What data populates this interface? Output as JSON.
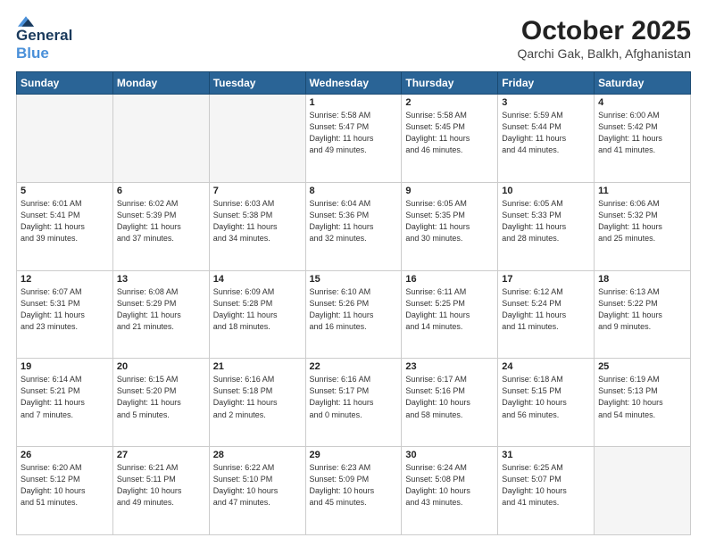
{
  "header": {
    "logo_general": "General",
    "logo_blue": "Blue",
    "month_title": "October 2025",
    "location": "Qarchi Gak, Balkh, Afghanistan"
  },
  "days_of_week": [
    "Sunday",
    "Monday",
    "Tuesday",
    "Wednesday",
    "Thursday",
    "Friday",
    "Saturday"
  ],
  "weeks": [
    [
      {
        "day": "",
        "info": ""
      },
      {
        "day": "",
        "info": ""
      },
      {
        "day": "",
        "info": ""
      },
      {
        "day": "1",
        "info": "Sunrise: 5:58 AM\nSunset: 5:47 PM\nDaylight: 11 hours\nand 49 minutes."
      },
      {
        "day": "2",
        "info": "Sunrise: 5:58 AM\nSunset: 5:45 PM\nDaylight: 11 hours\nand 46 minutes."
      },
      {
        "day": "3",
        "info": "Sunrise: 5:59 AM\nSunset: 5:44 PM\nDaylight: 11 hours\nand 44 minutes."
      },
      {
        "day": "4",
        "info": "Sunrise: 6:00 AM\nSunset: 5:42 PM\nDaylight: 11 hours\nand 41 minutes."
      }
    ],
    [
      {
        "day": "5",
        "info": "Sunrise: 6:01 AM\nSunset: 5:41 PM\nDaylight: 11 hours\nand 39 minutes."
      },
      {
        "day": "6",
        "info": "Sunrise: 6:02 AM\nSunset: 5:39 PM\nDaylight: 11 hours\nand 37 minutes."
      },
      {
        "day": "7",
        "info": "Sunrise: 6:03 AM\nSunset: 5:38 PM\nDaylight: 11 hours\nand 34 minutes."
      },
      {
        "day": "8",
        "info": "Sunrise: 6:04 AM\nSunset: 5:36 PM\nDaylight: 11 hours\nand 32 minutes."
      },
      {
        "day": "9",
        "info": "Sunrise: 6:05 AM\nSunset: 5:35 PM\nDaylight: 11 hours\nand 30 minutes."
      },
      {
        "day": "10",
        "info": "Sunrise: 6:05 AM\nSunset: 5:33 PM\nDaylight: 11 hours\nand 28 minutes."
      },
      {
        "day": "11",
        "info": "Sunrise: 6:06 AM\nSunset: 5:32 PM\nDaylight: 11 hours\nand 25 minutes."
      }
    ],
    [
      {
        "day": "12",
        "info": "Sunrise: 6:07 AM\nSunset: 5:31 PM\nDaylight: 11 hours\nand 23 minutes."
      },
      {
        "day": "13",
        "info": "Sunrise: 6:08 AM\nSunset: 5:29 PM\nDaylight: 11 hours\nand 21 minutes."
      },
      {
        "day": "14",
        "info": "Sunrise: 6:09 AM\nSunset: 5:28 PM\nDaylight: 11 hours\nand 18 minutes."
      },
      {
        "day": "15",
        "info": "Sunrise: 6:10 AM\nSunset: 5:26 PM\nDaylight: 11 hours\nand 16 minutes."
      },
      {
        "day": "16",
        "info": "Sunrise: 6:11 AM\nSunset: 5:25 PM\nDaylight: 11 hours\nand 14 minutes."
      },
      {
        "day": "17",
        "info": "Sunrise: 6:12 AM\nSunset: 5:24 PM\nDaylight: 11 hours\nand 11 minutes."
      },
      {
        "day": "18",
        "info": "Sunrise: 6:13 AM\nSunset: 5:22 PM\nDaylight: 11 hours\nand 9 minutes."
      }
    ],
    [
      {
        "day": "19",
        "info": "Sunrise: 6:14 AM\nSunset: 5:21 PM\nDaylight: 11 hours\nand 7 minutes."
      },
      {
        "day": "20",
        "info": "Sunrise: 6:15 AM\nSunset: 5:20 PM\nDaylight: 11 hours\nand 5 minutes."
      },
      {
        "day": "21",
        "info": "Sunrise: 6:16 AM\nSunset: 5:18 PM\nDaylight: 11 hours\nand 2 minutes."
      },
      {
        "day": "22",
        "info": "Sunrise: 6:16 AM\nSunset: 5:17 PM\nDaylight: 11 hours\nand 0 minutes."
      },
      {
        "day": "23",
        "info": "Sunrise: 6:17 AM\nSunset: 5:16 PM\nDaylight: 10 hours\nand 58 minutes."
      },
      {
        "day": "24",
        "info": "Sunrise: 6:18 AM\nSunset: 5:15 PM\nDaylight: 10 hours\nand 56 minutes."
      },
      {
        "day": "25",
        "info": "Sunrise: 6:19 AM\nSunset: 5:13 PM\nDaylight: 10 hours\nand 54 minutes."
      }
    ],
    [
      {
        "day": "26",
        "info": "Sunrise: 6:20 AM\nSunset: 5:12 PM\nDaylight: 10 hours\nand 51 minutes."
      },
      {
        "day": "27",
        "info": "Sunrise: 6:21 AM\nSunset: 5:11 PM\nDaylight: 10 hours\nand 49 minutes."
      },
      {
        "day": "28",
        "info": "Sunrise: 6:22 AM\nSunset: 5:10 PM\nDaylight: 10 hours\nand 47 minutes."
      },
      {
        "day": "29",
        "info": "Sunrise: 6:23 AM\nSunset: 5:09 PM\nDaylight: 10 hours\nand 45 minutes."
      },
      {
        "day": "30",
        "info": "Sunrise: 6:24 AM\nSunset: 5:08 PM\nDaylight: 10 hours\nand 43 minutes."
      },
      {
        "day": "31",
        "info": "Sunrise: 6:25 AM\nSunset: 5:07 PM\nDaylight: 10 hours\nand 41 minutes."
      },
      {
        "day": "",
        "info": ""
      }
    ]
  ]
}
